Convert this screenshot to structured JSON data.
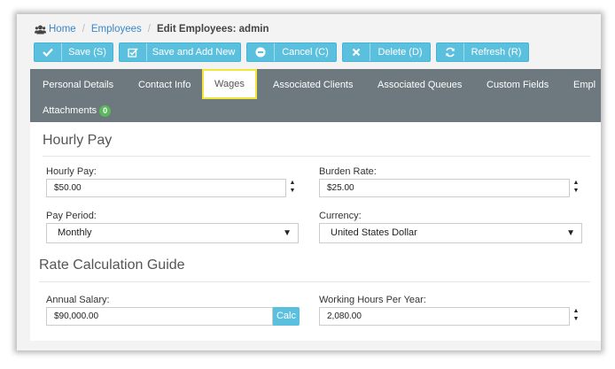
{
  "breadcrumb": {
    "home": "Home",
    "employees": "Employees",
    "current": "Edit Employees: admin"
  },
  "toolbar": {
    "save": "Save (S)",
    "save_add": "Save and Add New",
    "cancel": "Cancel (C)",
    "delete": "Delete (D)",
    "refresh": "Refresh (R)"
  },
  "tabs": {
    "personal": "Personal Details",
    "contact": "Contact Info",
    "wages": "Wages",
    "clients": "Associated Clients",
    "queues": "Associated Queues",
    "custom": "Custom Fields",
    "empl": "Empl",
    "attachments": "Attachments",
    "attachments_count": "0"
  },
  "hourly_pay_section": {
    "title": "Hourly Pay",
    "hourly_pay_label": "Hourly Pay:",
    "hourly_pay_value": "$50.00",
    "burden_rate_label": "Burden Rate:",
    "burden_rate_value": "$25.00",
    "pay_period_label": "Pay Period:",
    "pay_period_value": "Monthly",
    "currency_label": "Currency:",
    "currency_value": "United States Dollar"
  },
  "rate_guide_section": {
    "title": "Rate Calculation Guide",
    "annual_salary_label": "Annual Salary:",
    "annual_salary_value": "$90,000.00",
    "calc_label": "Calc",
    "working_hours_label": "Working Hours Per Year:",
    "working_hours_value": "2,080.00"
  },
  "icons": {
    "home": "users-icon",
    "save": "check-icon",
    "save_add": "checkbox-icon",
    "cancel": "minus-circle-icon",
    "delete": "x-icon",
    "refresh": "refresh-icon"
  },
  "colors": {
    "button": "#5bc0de",
    "tabbar": "#6d787f",
    "active_tab_border": "#f0e73a",
    "badge": "#5cb85c",
    "link": "#3a87c9"
  }
}
